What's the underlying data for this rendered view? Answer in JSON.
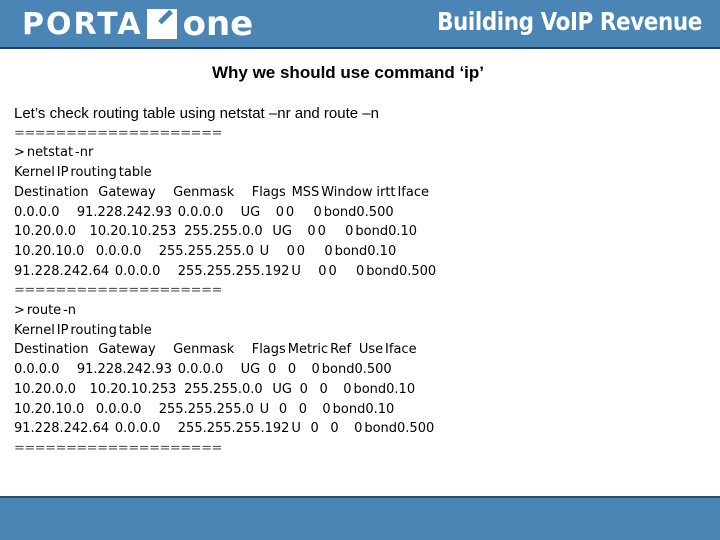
{
  "header": {
    "logo_left": "PORTA",
    "logo_right": "one",
    "tagline": "Building VoIP Revenue"
  },
  "slide": {
    "title": "Why we should use command ‘ip’",
    "intro": "Let’s check routing table using netstat –nr and route –n",
    "separator": "====================",
    "netstat": {
      "command": "> netstat -nr",
      "caption": "Kernel IP routing table",
      "header": "Destination     Gateway         Genmask         Flags   MSS Window  irtt Iface",
      "rows": [
        "0.0.0.0         91.228.242.93   0.0.0.0         UG        0 0          0 bond0.500",
        "10.20.0.0       10.20.10.253    255.255.0.0     UG        0 0          0 bond0.10",
        "10.20.10.0      0.0.0.0         255.255.255.0   U         0 0          0 bond0.10",
        "91.228.242.64   0.0.0.0         255.255.255.192 U         0 0          0 bond0.500"
      ]
    },
    "route": {
      "command": "> route -n",
      "caption": "Kernel IP routing table",
      "header": "Destination     Gateway         Genmask         Flags Metric Ref    Use Iface",
      "rows": [
        "0.0.0.0         91.228.242.93   0.0.0.0         UG    0      0        0 bond0.500",
        "10.20.0.0       10.20.10.253    255.255.0.0     UG    0      0        0 bond0.10",
        "10.20.10.0      0.0.0.0         255.255.255.0   U     0      0        0 bond0.10",
        "91.228.242.64   0.0.0.0         255.255.255.192 U     0      0        0 bond0.500"
      ]
    }
  },
  "colors": {
    "brand_blue": "#4a85b5",
    "border_dark": "#1e3f5e"
  }
}
